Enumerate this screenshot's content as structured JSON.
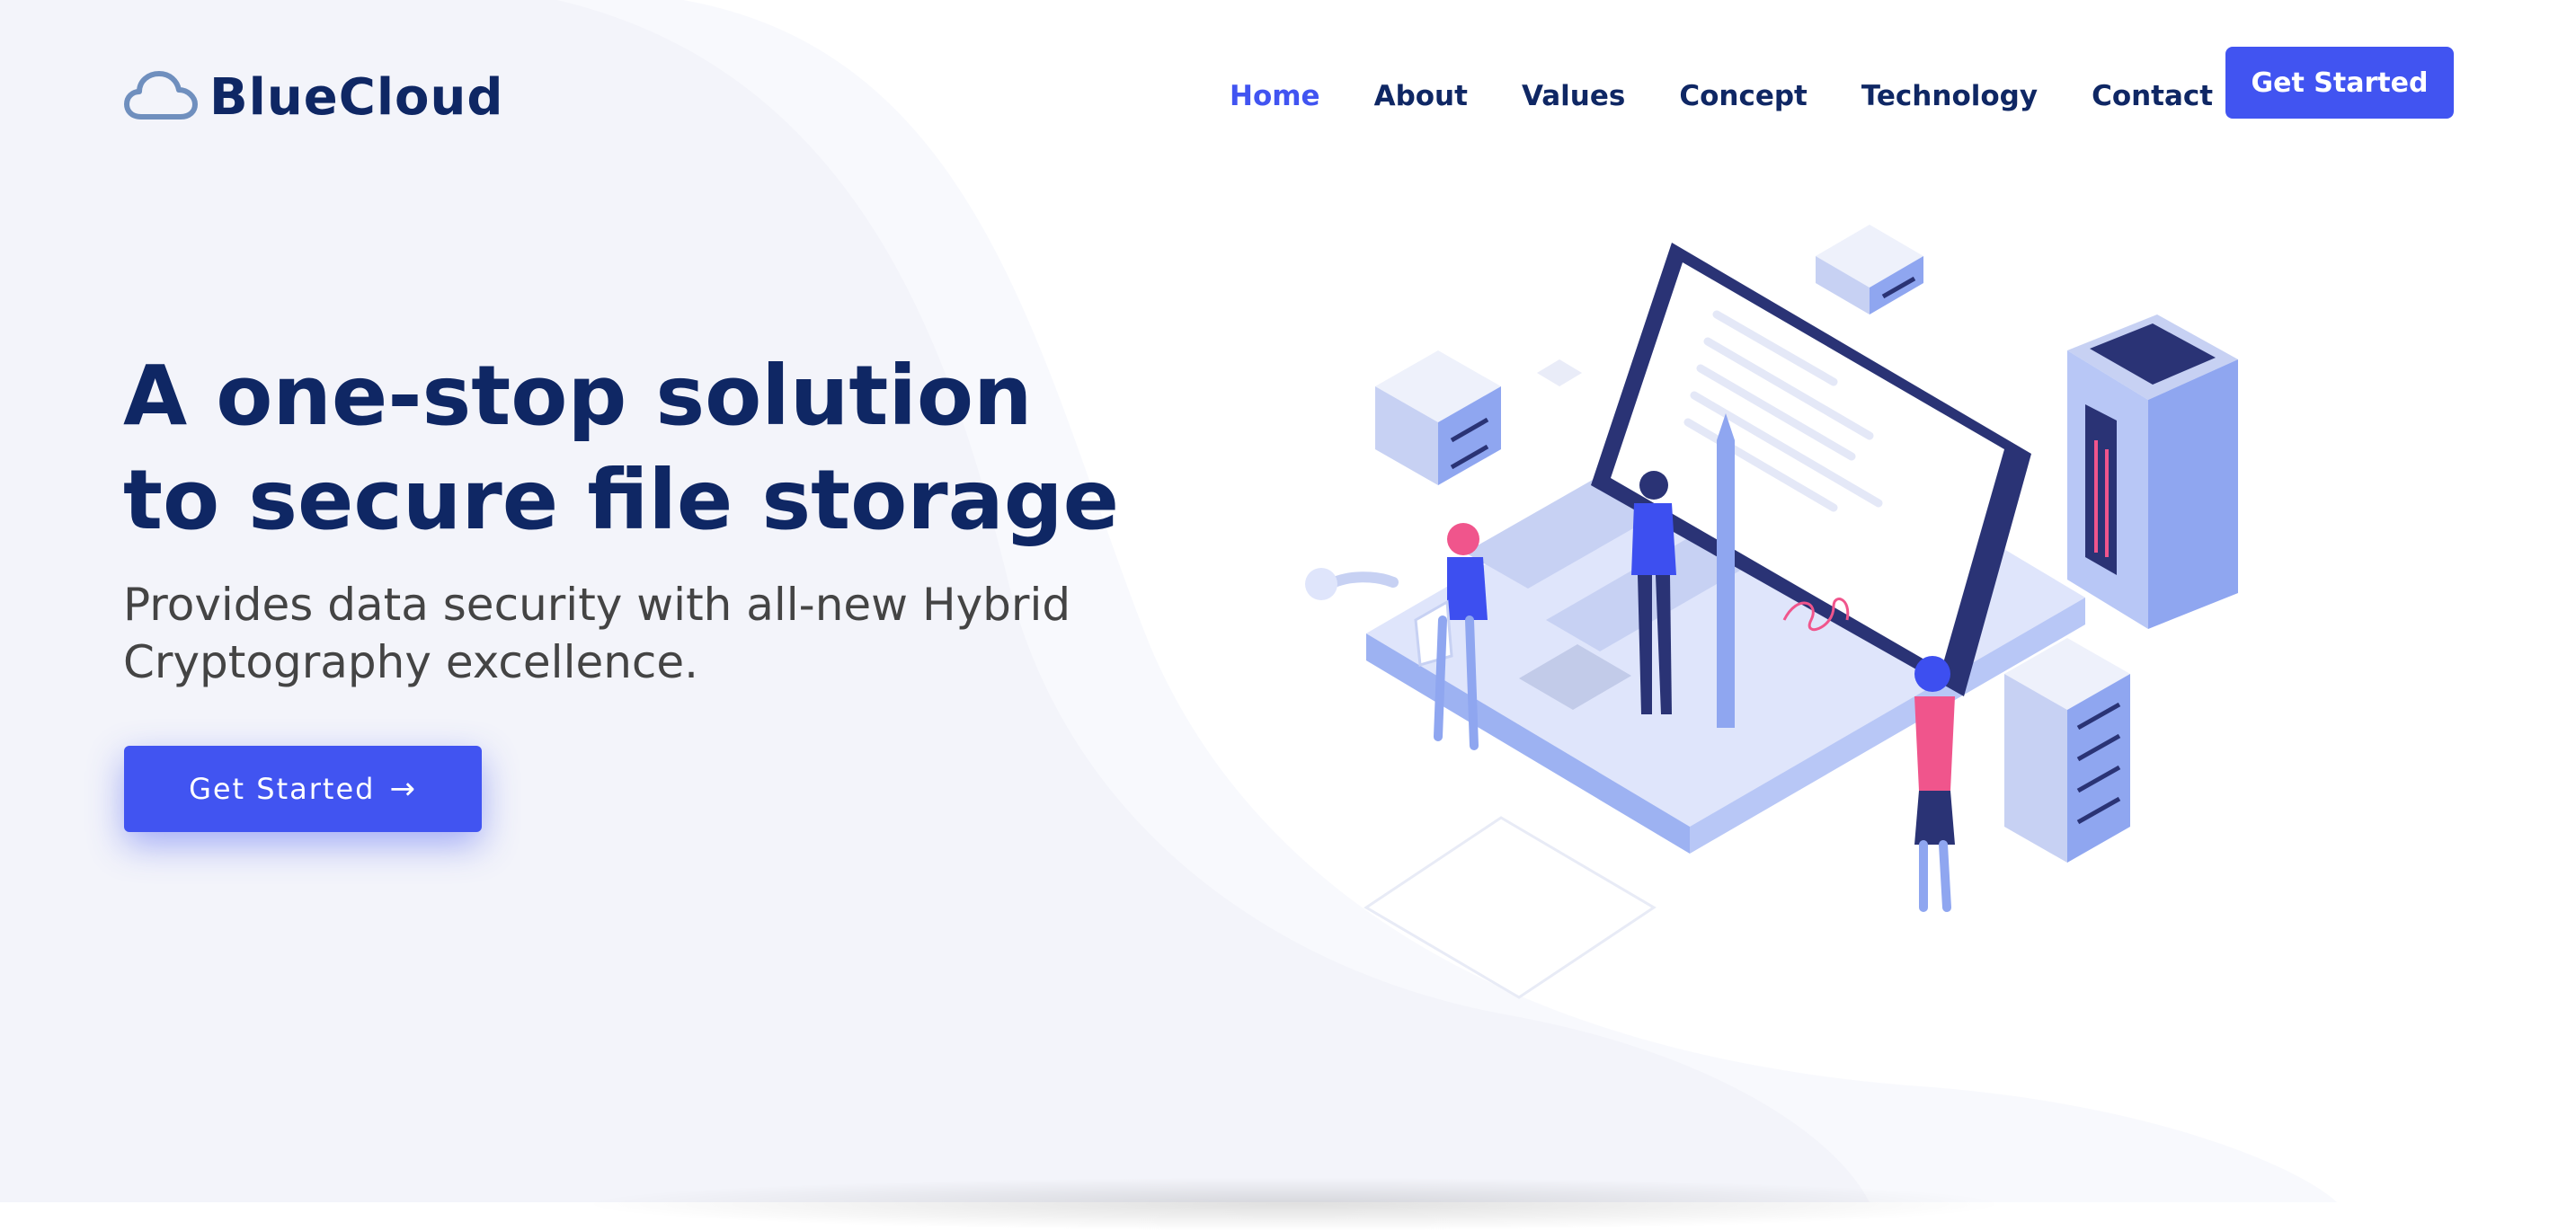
{
  "brand": {
    "name": "BlueCloud",
    "icon": "cloud-icon"
  },
  "nav": {
    "items": [
      {
        "label": "Home",
        "active": true
      },
      {
        "label": "About"
      },
      {
        "label": "Values"
      },
      {
        "label": "Concept"
      },
      {
        "label": "Technology"
      },
      {
        "label": "Contact"
      }
    ],
    "cta_label": "Get Started"
  },
  "hero": {
    "title": "A one-stop solution to secure file storage",
    "subtitle": "Provides data security with all-new Hybrid Cryptography excellence.",
    "cta_label": "Get Started",
    "cta_icon": "arrow-right-icon",
    "illustration": "isometric-laptop-servers-people"
  },
  "colors": {
    "primary": "#4154f1",
    "heading": "#0f2764",
    "text": "#444444",
    "background_wave": "#f3f4fa"
  }
}
